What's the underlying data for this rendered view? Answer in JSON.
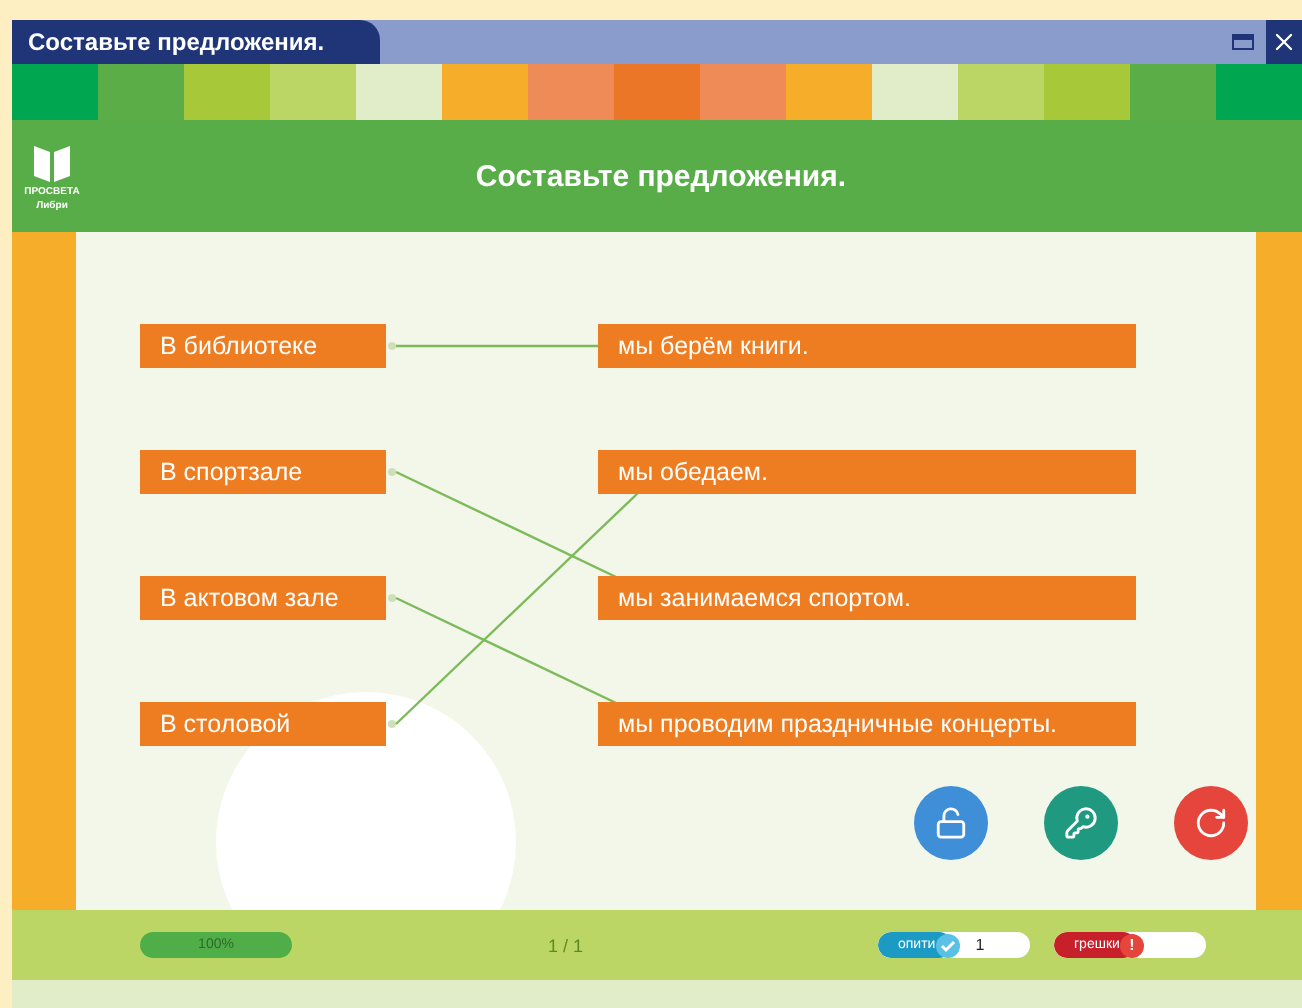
{
  "window": {
    "title": "Составьте предложения."
  },
  "header": {
    "title": "Составьте предложения.",
    "logo_text": [
      "ПРОСВЕТА",
      "Либри"
    ]
  },
  "left_items": [
    {
      "text": "В библиотеке"
    },
    {
      "text": "В спортзале"
    },
    {
      "text": "В актовом зале"
    },
    {
      "text": "В столовой"
    }
  ],
  "right_items": [
    {
      "text": "мы берём книги."
    },
    {
      "text": "мы обедаем."
    },
    {
      "text": "мы занимаемся спортом."
    },
    {
      "text": "мы проводим праздничные концерты."
    }
  ],
  "actions": [
    {
      "kind": "unlock"
    },
    {
      "kind": "key"
    },
    {
      "kind": "reload"
    }
  ],
  "footer": {
    "progress": {
      "level": 1,
      "label": "100%"
    },
    "page": "1 / 1",
    "attempts": {
      "label": "опити",
      "count": "1"
    },
    "errors": {
      "label": "грешки",
      "mark": "!"
    }
  }
}
